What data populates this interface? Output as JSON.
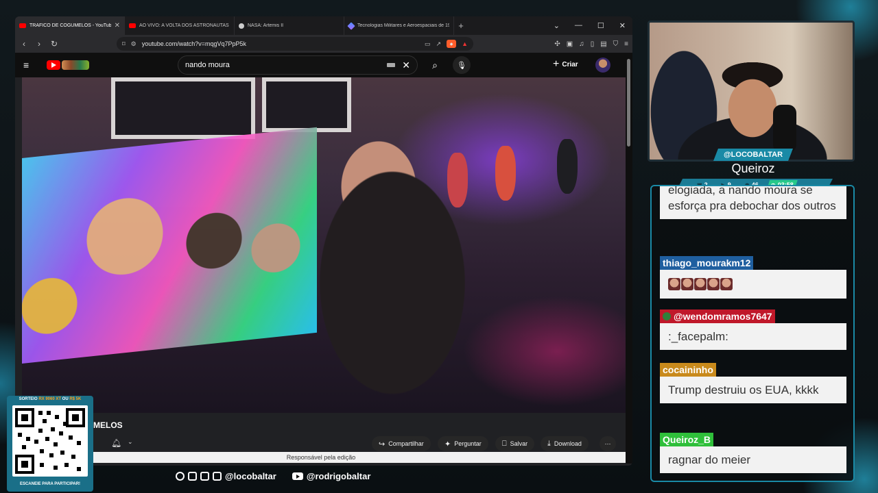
{
  "browser": {
    "tabs": [
      {
        "title": "TRÁFICO DE COGUMELOS - YouTube",
        "favicon": "youtube-icon",
        "active": true
      },
      {
        "title": "AO VIVO: A VOLTA DOS ASTRONAUTAS DA",
        "favicon": "youtube-icon",
        "active": false
      },
      {
        "title": "NASA: Artemis II",
        "favicon": "nasa-icon",
        "active": false
      },
      {
        "title": "Tecnologias Militares e Aeroespaciais de 19",
        "favicon": "gemini-icon",
        "active": false
      }
    ],
    "new_tab": "+",
    "url": "youtube.com/watch?v=mqgVq7PpP5k",
    "status_text": "Responsável pela edição"
  },
  "youtube": {
    "search_value": "nando moura",
    "create_label": "Criar",
    "video_title_partial": "MELOS",
    "actions": {
      "share": "Compartilhar",
      "ask": "Perguntar",
      "save": "Salvar",
      "download": "Download"
    }
  },
  "stream": {
    "handle": "@LOCOBALTAR",
    "display_name": "Queiroz",
    "stats": {
      "chat_count": "2",
      "viewers": "9",
      "followers": "46",
      "uptime": "03:58"
    },
    "socials": {
      "handle_1": "@locobaltar",
      "handle_2": "@rodrigobaltar"
    },
    "qr": {
      "top_pre": "SORTEIO",
      "top_hl1": "RX 9060 XT",
      "top_mid": "OU",
      "top_hl2": "R$ 5K",
      "bottom": "ESCANEIE PARA PARTICIPAR!"
    }
  },
  "chat": {
    "messages": [
      {
        "user": "",
        "text": "elogiada, a nando moura se esforça pra debochar dos outros"
      },
      {
        "user": "thiago_mourakm12",
        "user_color": "#1f5fa0",
        "text": ""
      },
      {
        "user": "@wendomramos7647",
        "user_color": "#c0182a",
        "text": ":_facepalm:"
      },
      {
        "user": "cocaininho",
        "user_color": "#c98a1c",
        "text": "Trump destruiu os EUA, kkkk"
      },
      {
        "user": "Queiroz_B",
        "user_color": "#2fbf3a",
        "text": "ragnar do meier"
      }
    ]
  }
}
